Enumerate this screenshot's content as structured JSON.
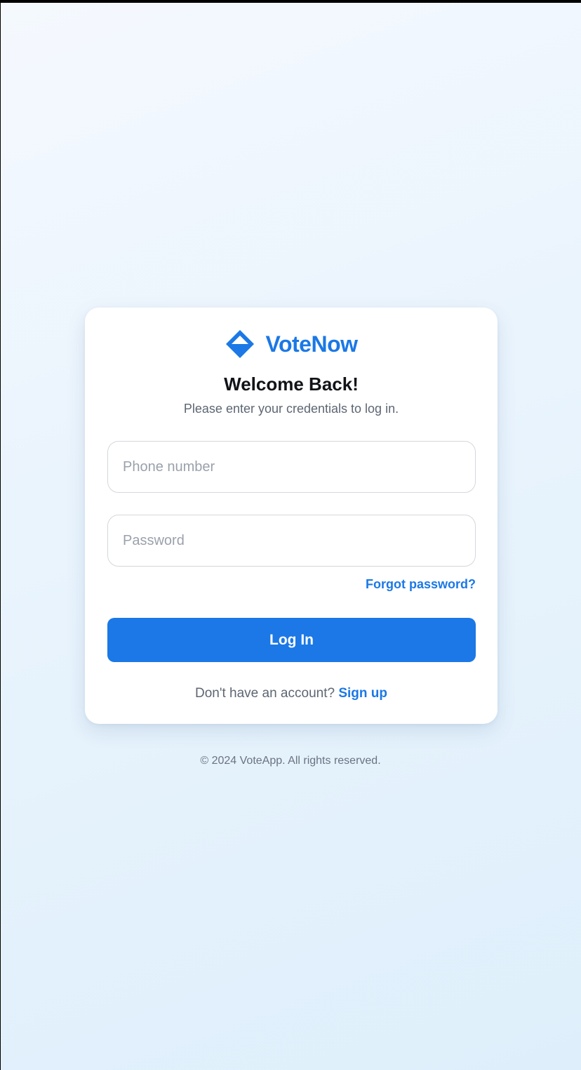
{
  "brand": {
    "name": "VoteNow",
    "icon": "diamond-ballot-icon",
    "color": "#1b78e6"
  },
  "login": {
    "title": "Welcome Back!",
    "subtitle": "Please enter your credentials to log in.",
    "phone_placeholder": "Phone number",
    "phone_value": "",
    "password_placeholder": "Password",
    "password_value": "",
    "forgot_label": "Forgot password?",
    "submit_label": "Log In",
    "signup_prompt": "Don't have an account?",
    "signup_label": "Sign up"
  },
  "footer": {
    "text": "© 2024 VoteApp. All rights reserved."
  },
  "colors": {
    "accent": "#1b78e6",
    "title_text": "#111318",
    "muted_text": "#5d6673"
  }
}
